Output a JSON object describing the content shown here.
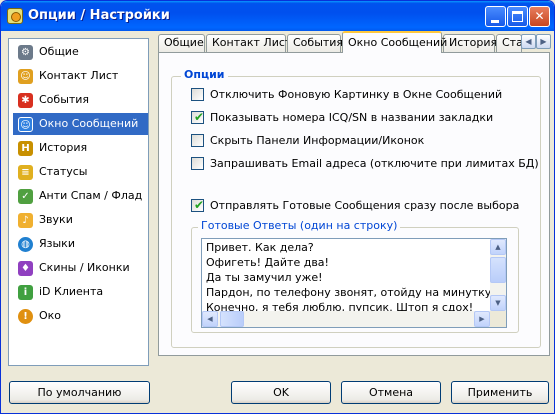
{
  "window": {
    "title": "Опции / Настройки",
    "accent": "#0054e3"
  },
  "sidebar": {
    "selected": "Окно Сообщений",
    "items": [
      {
        "label": "Общие",
        "icon": "settings-icon",
        "color": "#6c7a8a"
      },
      {
        "label": "Контакт Лист",
        "icon": "contact-icon",
        "color": "#e0a020"
      },
      {
        "label": "События",
        "icon": "events-icon",
        "color": "#d83020"
      },
      {
        "label": "Окно Сообщений",
        "icon": "message-window-icon",
        "color": "#3080e0"
      },
      {
        "label": "История",
        "icon": "history-icon",
        "color": "#c89000"
      },
      {
        "label": "Статусы",
        "icon": "status-icon",
        "color": "#e0b020"
      },
      {
        "label": "Анти Спам / Флад",
        "icon": "shield-icon",
        "color": "#50a040"
      },
      {
        "label": "Звуки",
        "icon": "sound-icon",
        "color": "#f0b030"
      },
      {
        "label": "Языки",
        "icon": "globe-icon",
        "color": "#2080d0"
      },
      {
        "label": "Скины / Иконки",
        "icon": "skin-icon",
        "color": "#9040c0"
      },
      {
        "label": "iD Клиента",
        "icon": "client-id-icon",
        "color": "#40a040"
      },
      {
        "label": "Око",
        "icon": "eye-icon",
        "color": "#e09010"
      }
    ]
  },
  "tabs": [
    {
      "label": "Общие"
    },
    {
      "label": "Контакт Лист"
    },
    {
      "label": "События"
    },
    {
      "label": "Окно Сообщений"
    },
    {
      "label": "История"
    },
    {
      "label": "Ста"
    }
  ],
  "options": {
    "legend": "Опции",
    "checkboxes": [
      {
        "label": "Отключить Фоновую Картинку в Окне Сообщений",
        "checked": false
      },
      {
        "label": "Показывать номера ICQ/SN в названии закладки",
        "checked": true
      },
      {
        "label": "Скрыть Панели Информации/Иконок",
        "checked": false
      },
      {
        "label": "Запрашивать Email адреса (отключите при лимитах БД)",
        "checked": false
      },
      {
        "label": "Отправлять Готовые Сообщения сразу после выбора",
        "checked": true
      }
    ],
    "check_mark": "✔"
  },
  "ready_answers": {
    "legend": "Готовые Ответы (один на строку)",
    "lines": [
      "Привет. Как дела?",
      "Офигеть! Дайте два!",
      "Да ты замучил уже!",
      "Пардон, по телефону звонят, отойду на минутку.",
      "Конечно, я тебя люблю, пупсик. Штоп я сдох!"
    ]
  },
  "buttons": {
    "default": "По умолчанию",
    "ok": "OK",
    "cancel": "Отмена",
    "apply": "Применить"
  }
}
